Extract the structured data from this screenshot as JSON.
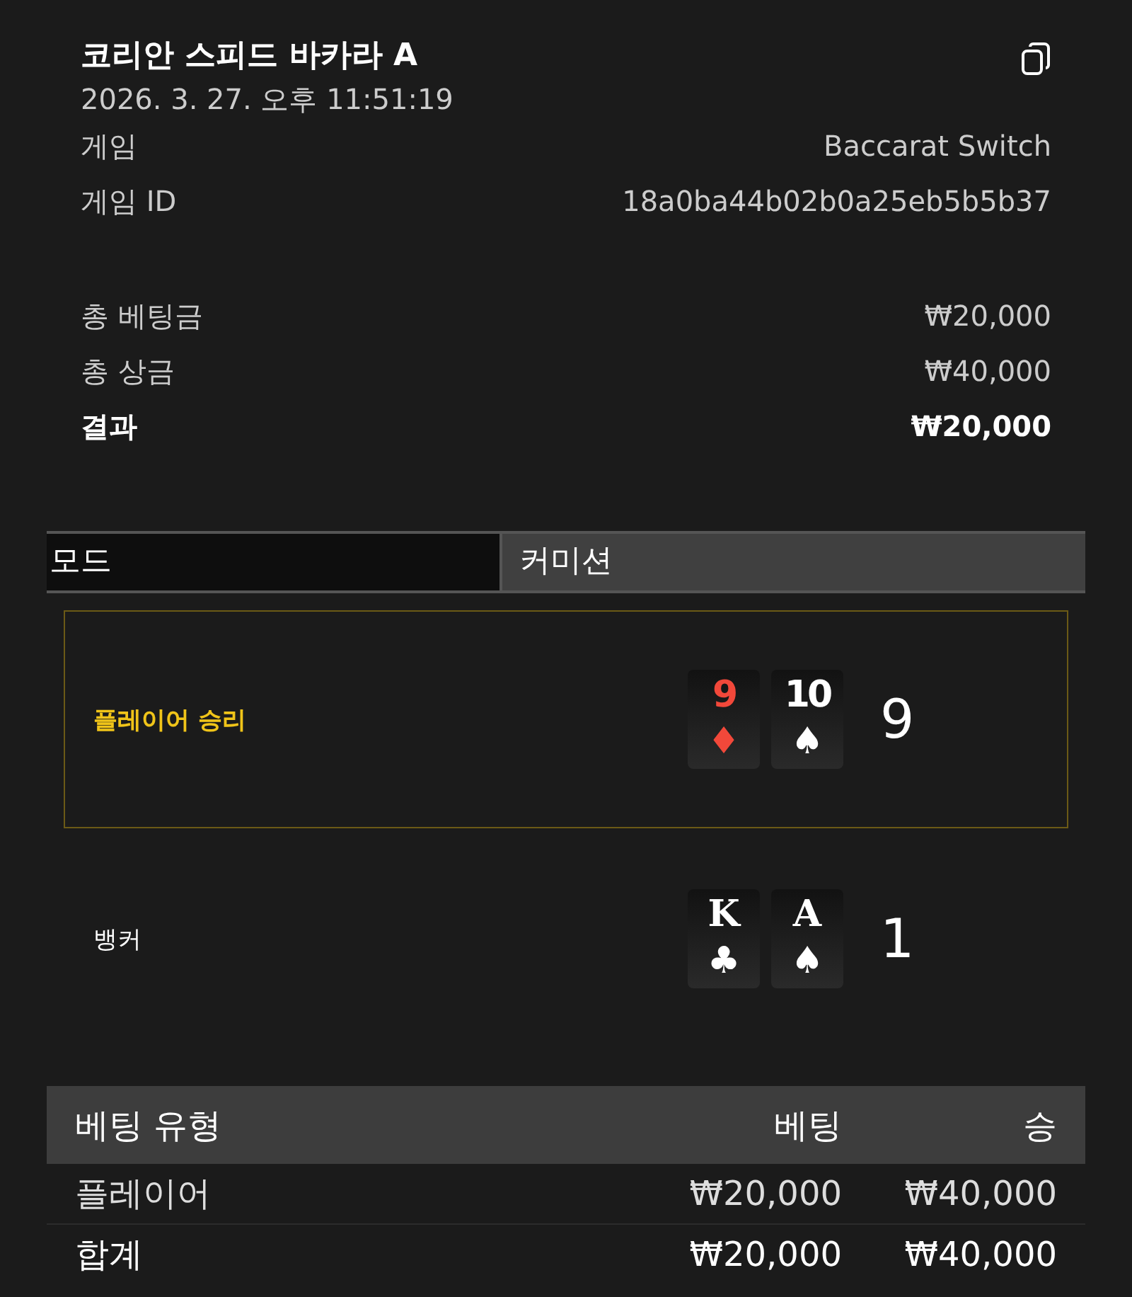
{
  "header": {
    "title": "코리안 스피드 바카라 A",
    "datetime": "2026. 3. 27. 오후 11:51:19"
  },
  "info": [
    {
      "label": "게임",
      "value": "Baccarat Switch"
    },
    {
      "label": "게임 ID",
      "value": "18a0ba44b02b0a25eb5b5b37"
    }
  ],
  "summary": [
    {
      "label": "총 베팅금",
      "value": "₩20,000",
      "emphasis": false
    },
    {
      "label": "총 상금",
      "value": "₩40,000",
      "emphasis": false
    },
    {
      "label": "결과",
      "value": "₩20,000",
      "emphasis": true
    }
  ],
  "mode": {
    "label": "모드",
    "value": "커미션"
  },
  "hands": [
    {
      "label": "플레이어 승리",
      "winner": true,
      "score": "9",
      "cards": [
        {
          "rank": "9",
          "suit": "♦",
          "red": true
        },
        {
          "rank": "10",
          "suit": "♠",
          "red": false
        }
      ]
    },
    {
      "label": "뱅커",
      "winner": false,
      "score": "1",
      "cards": [
        {
          "rank": "K",
          "suit": "♣",
          "red": false
        },
        {
          "rank": "A",
          "suit": "♠",
          "red": false
        }
      ]
    }
  ],
  "bets_table": {
    "columns": [
      "베팅 유형",
      "베팅",
      "승"
    ],
    "rows": [
      {
        "cells": [
          "플레이어",
          "₩20,000",
          "₩40,000"
        ]
      },
      {
        "cells": [
          "합계",
          "₩20,000",
          "₩40,000"
        ]
      }
    ]
  }
}
